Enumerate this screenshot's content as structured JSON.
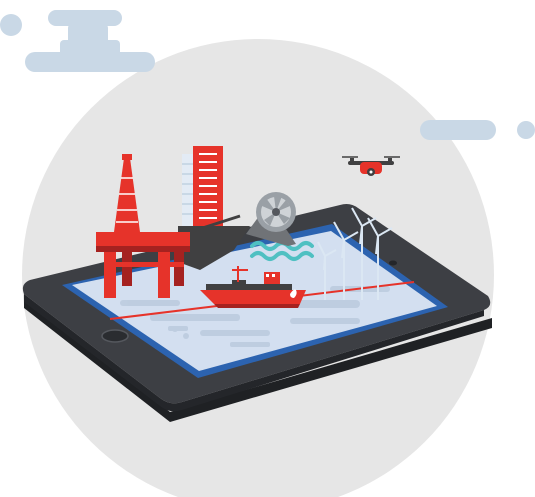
{
  "illustration": {
    "subject": "tablet-with-offshore-energy-scene",
    "elements": [
      "oil-rig",
      "office-tower",
      "water-turbine",
      "wind-turbines",
      "tanker-ship",
      "drone",
      "clouds"
    ]
  },
  "colors": {
    "background": "#ffffff",
    "circle": "#e6e6e6",
    "cloud": "#c9d8e6",
    "tablet_body": "#3d3f44",
    "tablet_edge": "#24262a",
    "screen_border": "#2c63b0",
    "screen": "#d3dff0",
    "screen_pattern": "#bcccdf",
    "accent_red": "#e6332a",
    "accent_dark_red": "#a52220",
    "dark_gray": "#404041",
    "turbine_gray": "#9aa0a6",
    "water_teal": "#4fc0c2"
  }
}
